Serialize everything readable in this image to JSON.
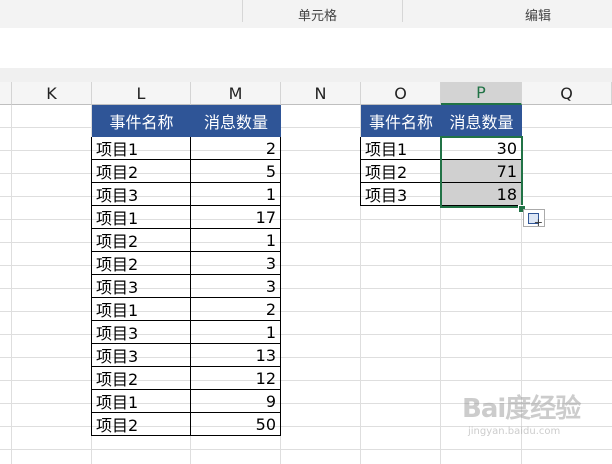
{
  "ribbon": {
    "groups": [
      "单元格",
      "编辑"
    ]
  },
  "colors": {
    "header_fill": "#2f5597",
    "selection": "#217346",
    "shaded": "#d0d0d0"
  },
  "columns": [
    "K",
    "L",
    "M",
    "N",
    "O",
    "P",
    "Q"
  ],
  "selected_column": "P",
  "table1": {
    "headers": [
      "事件名称",
      "消息数量"
    ],
    "rows": [
      [
        "项目1",
        "2"
      ],
      [
        "项目2",
        "5"
      ],
      [
        "项目3",
        "1"
      ],
      [
        "项目1",
        "17"
      ],
      [
        "项目2",
        "1"
      ],
      [
        "项目2",
        "3"
      ],
      [
        "项目3",
        "3"
      ],
      [
        "项目1",
        "2"
      ],
      [
        "项目3",
        "1"
      ],
      [
        "项目3",
        "13"
      ],
      [
        "项目2",
        "12"
      ],
      [
        "项目1",
        "9"
      ],
      [
        "项目2",
        "50"
      ]
    ]
  },
  "table2": {
    "headers": [
      "事件名称",
      "消息数量"
    ],
    "rows": [
      [
        "项目1",
        "30"
      ],
      [
        "项目2",
        "71"
      ],
      [
        "项目3",
        "18"
      ]
    ]
  },
  "watermark": {
    "logo": "Bai度经验",
    "url": "jingyan.baidu.com"
  },
  "icons": {
    "paste_options": "paste-options-icon"
  }
}
